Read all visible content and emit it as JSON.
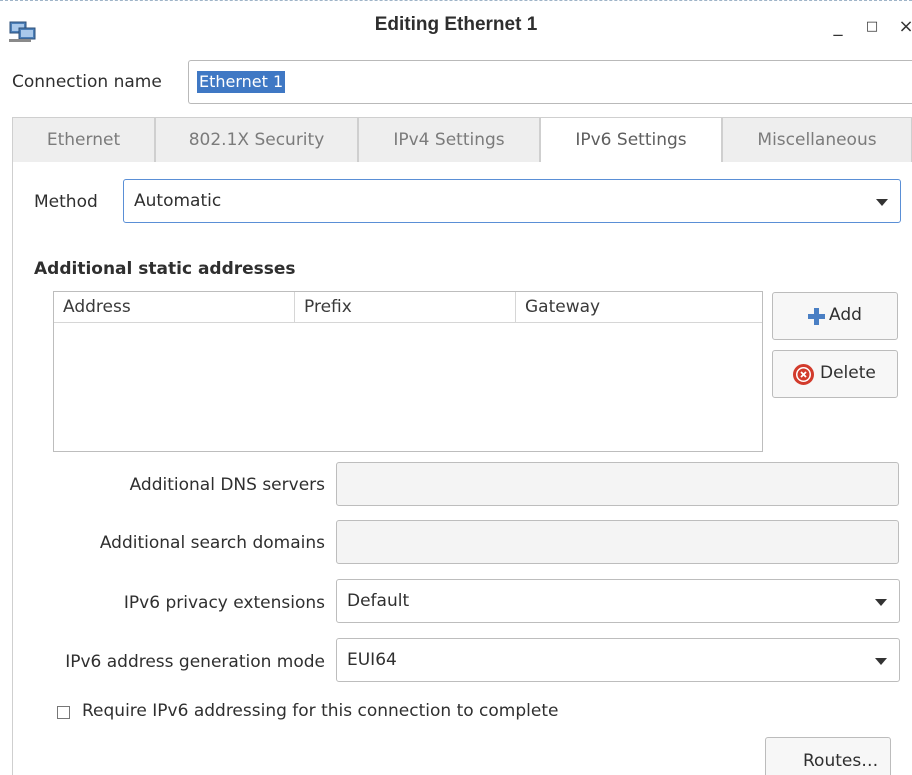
{
  "window": {
    "title": "Editing Ethernet 1",
    "minimize_glyph": "_",
    "maximize_glyph": "□",
    "close_glyph": "×"
  },
  "connection": {
    "label": "Connection name",
    "value": "Ethernet 1"
  },
  "tabs": [
    {
      "label": "Ethernet"
    },
    {
      "label": "802.1X Security"
    },
    {
      "label": "IPv4 Settings"
    },
    {
      "label": "IPv6 Settings",
      "active": true
    },
    {
      "label": "Miscellaneous"
    }
  ],
  "ipv6": {
    "method_label": "Method",
    "method_value": "Automatic",
    "static_title": "Additional static addresses",
    "columns": [
      "Address",
      "Prefix",
      "Gateway"
    ],
    "add_label": "Add",
    "delete_label": "Delete",
    "dns_label": "Additional DNS servers",
    "dns_value": "",
    "search_label": "Additional search domains",
    "search_value": "",
    "privacy_label": "IPv6 privacy extensions",
    "privacy_value": "Default",
    "genmode_label": "IPv6 address generation mode",
    "genmode_value": "EUI64",
    "require_label": "Require IPv6 addressing for this connection to complete",
    "require_checked": false,
    "routes_label": "Routes…"
  },
  "colors": {
    "selection": "#3f78c4",
    "add_icon": "#4a7fc4",
    "delete_icon": "#d23b2c"
  },
  "icons": [
    "network-icon",
    "plus-icon",
    "delete-icon",
    "chevron-down-icon"
  ]
}
